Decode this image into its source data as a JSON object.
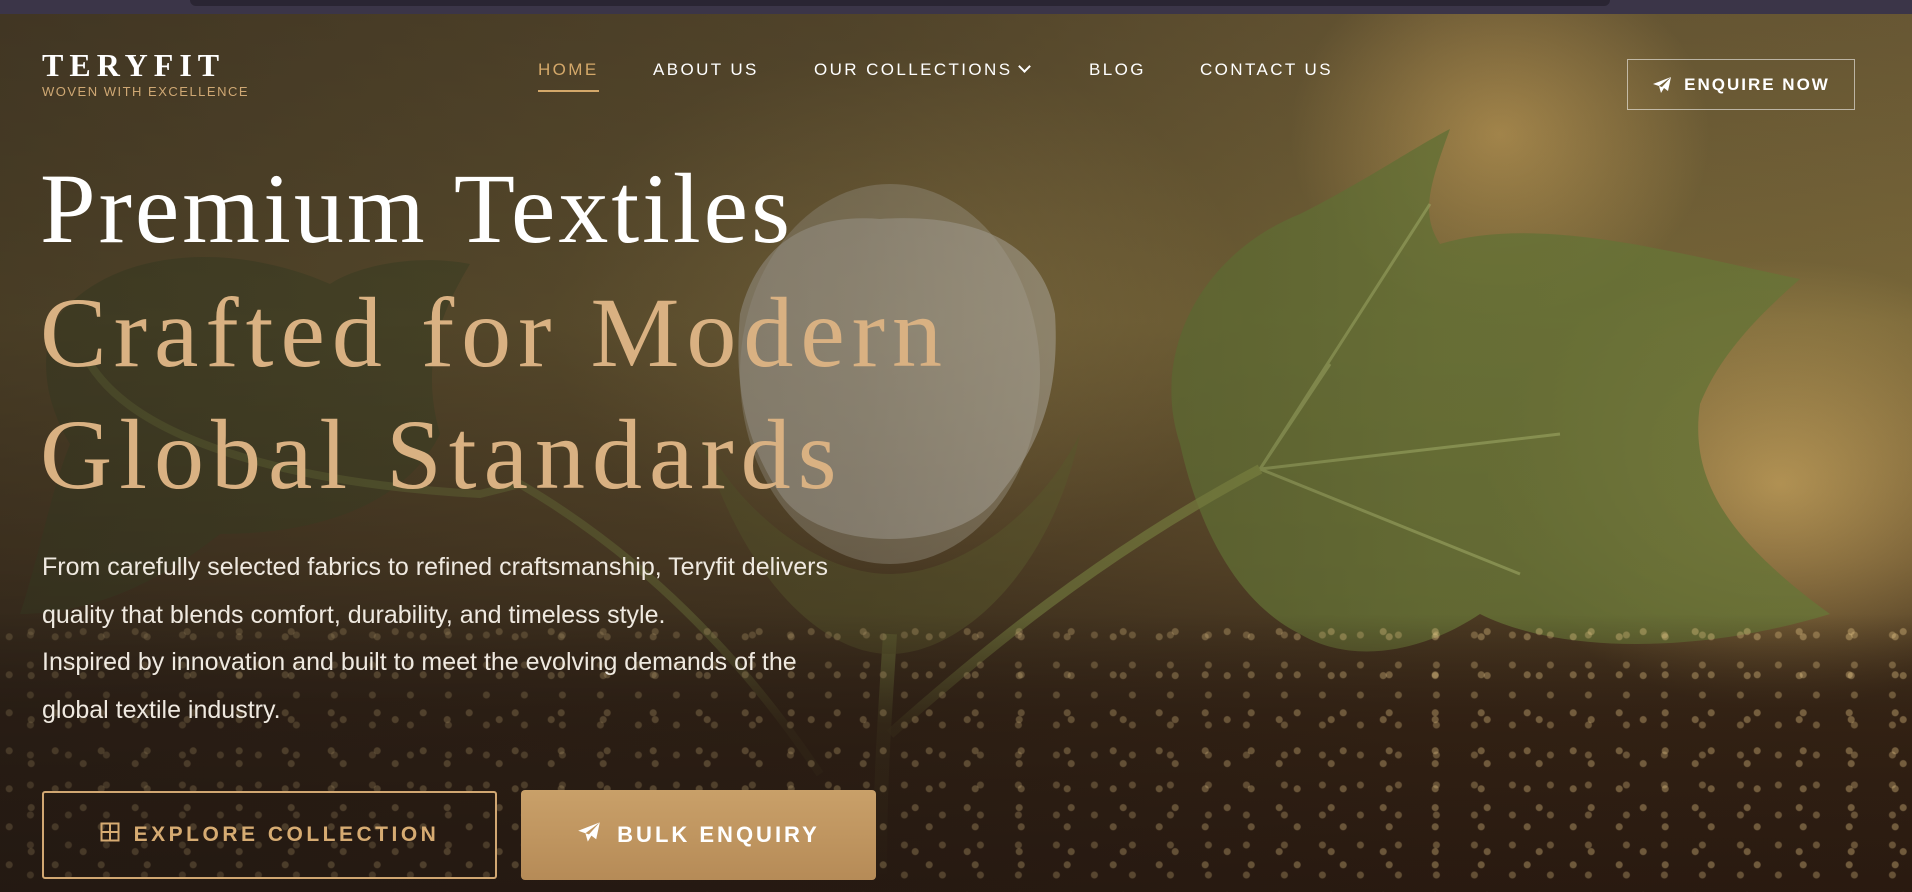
{
  "brand": {
    "name": "TERYFIT",
    "tagline": "WOVEN WITH EXCELLENCE"
  },
  "nav": {
    "items": [
      {
        "label": "HOME",
        "active": true
      },
      {
        "label": "ABOUT US"
      },
      {
        "label": "OUR COLLECTIONS",
        "has_dropdown": true
      },
      {
        "label": "BLOG"
      },
      {
        "label": "CONTACT US"
      }
    ]
  },
  "header_cta": {
    "label": "ENQUIRE NOW",
    "icon": "paper-plane-icon"
  },
  "hero": {
    "title_line1": "Premium Textiles",
    "title_line2": "Crafted for Modern",
    "title_line3": "Global Standards",
    "paragraph1_line1": "From carefully selected fabrics to refined craftsmanship, Teryfit delivers",
    "paragraph1_line2": "quality that blends comfort, durability, and timeless style.",
    "paragraph2_line1": "Inspired by innovation and built to meet the evolving demands of the",
    "paragraph2_line2": "global textile industry."
  },
  "buttons": {
    "explore": {
      "label": "EXPLORE COLLECTION",
      "icon": "grid-icon"
    },
    "bulk": {
      "label": "BULK ENQUIRY",
      "icon": "paper-plane-icon"
    }
  },
  "colors": {
    "accent_gold": "#d4a86a",
    "button_fill": "#c19660",
    "text_white": "#ffffff"
  }
}
